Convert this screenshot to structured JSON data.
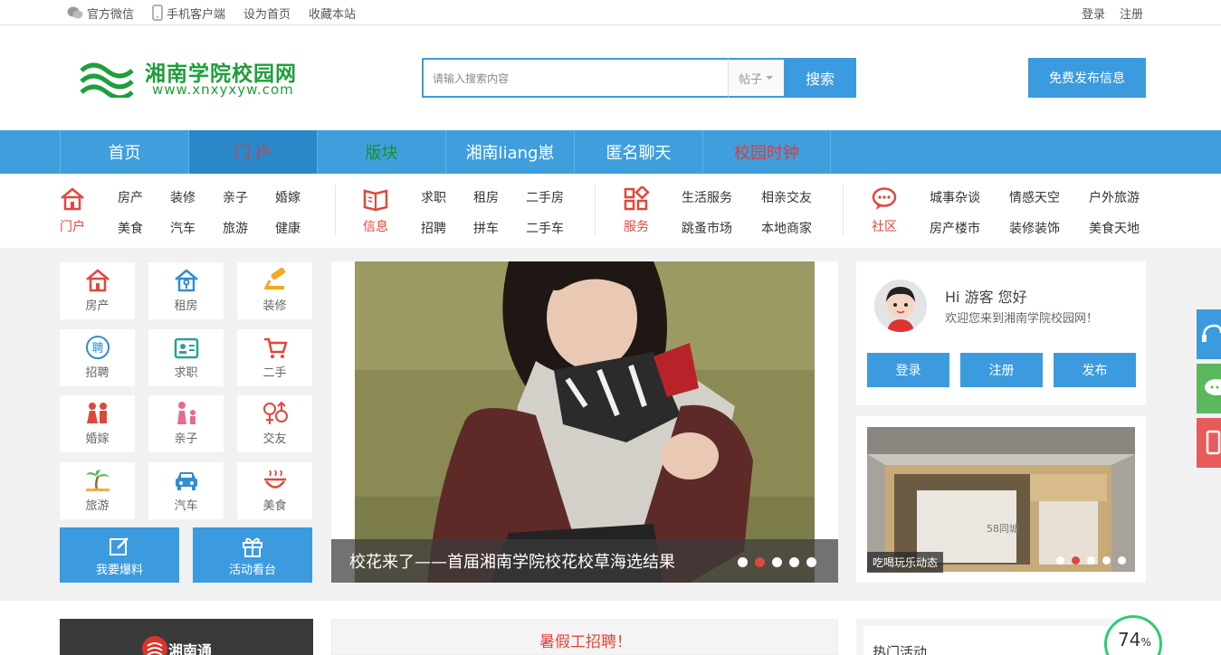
{
  "topbar": {
    "wechat": "官方微信",
    "mobile": "手机客户端",
    "homepage": "设为首页",
    "favorite": "收藏本站",
    "login": "登录",
    "register": "注册"
  },
  "logo": {
    "cn": "湘南学院校园网",
    "en": "www.xnxyxyw.com"
  },
  "search": {
    "placeholder": "请输入搜索内容",
    "type": "帖子",
    "button": "搜索"
  },
  "publish": "免费发布信息",
  "nav": [
    "首页",
    "门 户",
    "版块",
    "湘南liang崽",
    "匿名聊天",
    "校园时钟"
  ],
  "categories": {
    "portal": {
      "label": "门户",
      "links": [
        "房产",
        "装修",
        "亲子",
        "婚嫁",
        "美食",
        "汽车",
        "旅游",
        "健康"
      ]
    },
    "info": {
      "label": "信息",
      "links": [
        "求职",
        "租房",
        "二手房",
        "招聘",
        "拼车",
        "二手车"
      ]
    },
    "service": {
      "label": "服务",
      "links": [
        "生活服务",
        "相亲交友",
        "跳蚤市场",
        "本地商家"
      ]
    },
    "community": {
      "label": "社区",
      "links": [
        "城事杂谈",
        "情感天空",
        "户外旅游",
        "房产楼市",
        "装修装饰",
        "美食天地"
      ]
    }
  },
  "tiles": [
    "房产",
    "租房",
    "装修",
    "招聘",
    "求职",
    "二手",
    "婚嫁",
    "亲子",
    "交友",
    "旅游",
    "汽车",
    "美食"
  ],
  "big_buttons": [
    "我要爆料",
    "活动看台"
  ],
  "slider": {
    "caption": "校花来了——首届湘南学院校花校草海选结果",
    "slides": 5,
    "active": 2
  },
  "user": {
    "greeting": "Hi 游客 您好",
    "welcome": "欢迎您来到湘南学院校园网！",
    "login": "登录",
    "register": "注册",
    "post": "发布"
  },
  "ad": {
    "tag": "吃喝玩乐动态",
    "watermark": "58同城",
    "slides": 5,
    "active": 2
  },
  "bottom": {
    "left_title": "湘南通",
    "middle_title": "暑假工招聘！",
    "right_title": "热门活动",
    "progress": "74",
    "progress_unit": "%"
  },
  "colors": {
    "primary": "#3b9bde",
    "nav": "#3f9fdc",
    "accent_red": "#e0473c",
    "logo_green": "#1f9e3a"
  }
}
